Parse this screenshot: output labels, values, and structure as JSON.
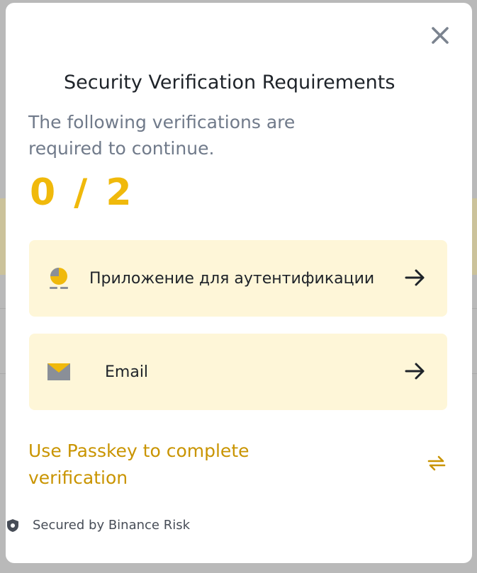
{
  "modal": {
    "title": "Security Verification Requirements",
    "subtitle": "The following verifications are required to continue.",
    "progress": "0 / 2",
    "options": [
      {
        "label": "Приложение для аутентификации",
        "icon": "authenticator-icon"
      },
      {
        "label": "Email",
        "icon": "mail-icon"
      }
    ],
    "passkey_link": "Use Passkey to complete verification",
    "footer": "Secured by Binance Risk"
  },
  "colors": {
    "accent": "#F0B90B",
    "link": "#C99400",
    "option_bg": "#FEF6D8",
    "text_primary": "#1E2329",
    "text_secondary": "#707A8A"
  }
}
